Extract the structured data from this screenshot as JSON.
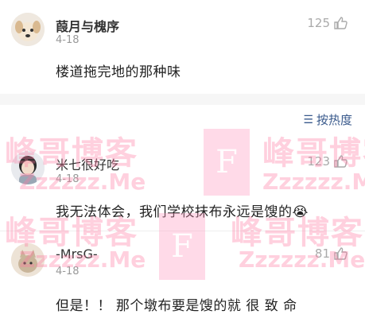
{
  "comments": [
    {
      "username": "葭月与槐序",
      "date": "4-18",
      "likes": "125",
      "text": "楼道拖完地的那种味"
    },
    {
      "username": "米七很好吃",
      "date": "4-18",
      "likes": "123",
      "text": "我无法体会，我们学校抹布永远是馊的😭"
    },
    {
      "username": "-MrsG-",
      "date": "4-18",
      "likes": "81",
      "text": "但是！！ 那个墩布要是馊的就 很 致 命"
    }
  ],
  "sort": {
    "label": "按热度",
    "icon": "sort-icon"
  },
  "watermark": {
    "text": "峰哥博客",
    "sub": "Zzzzzz.Me",
    "letter": "F"
  },
  "colors": {
    "sort_link": "#3a5a8c",
    "muted": "#999999",
    "watermark": "#ff78a0"
  }
}
